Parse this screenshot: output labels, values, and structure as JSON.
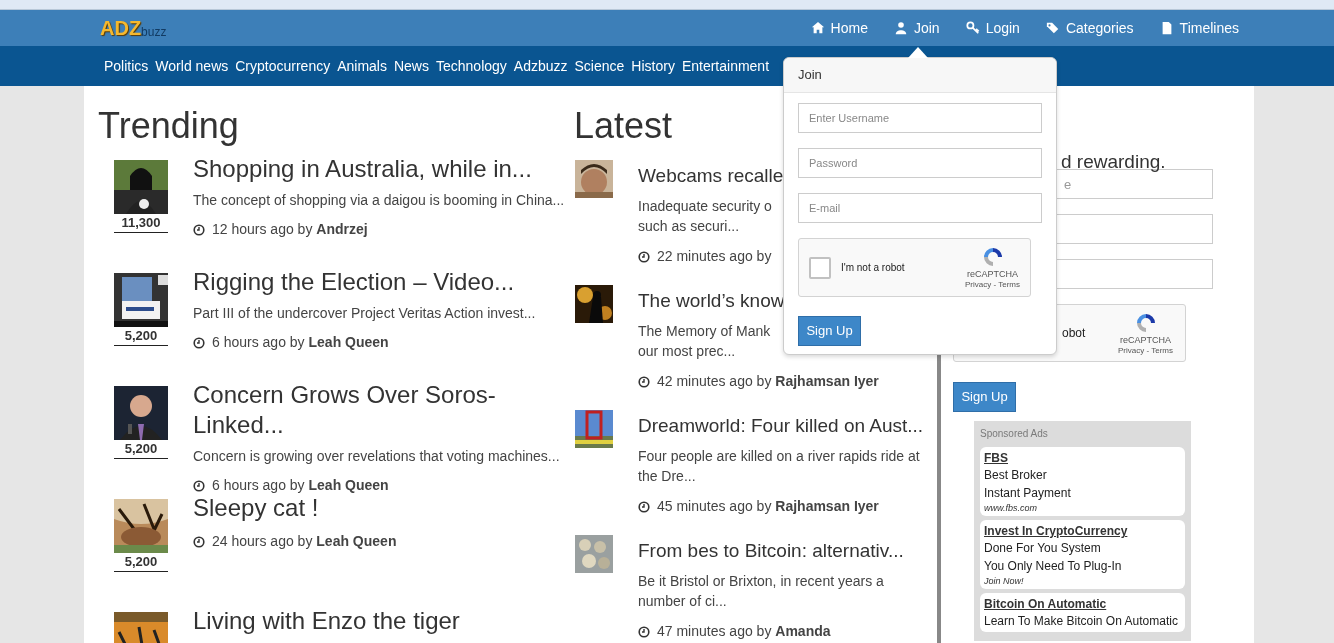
{
  "logo": {
    "primary": "ADZ",
    "secondary": "buzz"
  },
  "nav": [
    {
      "label": "Home"
    },
    {
      "label": "Join"
    },
    {
      "label": "Login"
    },
    {
      "label": "Categories"
    },
    {
      "label": "Timelines"
    }
  ],
  "categories": [
    "Politics",
    "World news",
    "Cryptocurrency",
    "Animals",
    "News",
    "Technology",
    "Adzbuzz",
    "Science",
    "History",
    "Entertainment"
  ],
  "trending": {
    "heading": "Trending",
    "items": [
      {
        "title": "Shopping in Australia, while in...",
        "count": "11,300",
        "summary": "The concept of shopping via a daigou is booming in China...",
        "meta": "12 hours ago by **Andrzej**"
      },
      {
        "title": "Rigging the Election – Video...",
        "count": "5,200",
        "summary": "Part III of the undercover Project Veritas Action invest...",
        "meta": "6 hours ago by **Leah Queen**"
      },
      {
        "title": "Concern Grows Over Soros-Linked...",
        "count": "5,200",
        "summary": "Concern is growing over revelations that voting machines...",
        "meta": "6 hours ago by **Leah Queen**"
      },
      {
        "title": "Sleepy cat !",
        "count": "5,200",
        "meta": "24 hours ago by **Leah Queen**"
      },
      {
        "title": "Living with Enzo the tiger"
      }
    ]
  },
  "latest": {
    "heading": "Latest",
    "items": [
      {
        "title": "Webcams recalle",
        "summary": [
          "Inadequate security o",
          "such as securi..."
        ],
        "meta": "22 minutes ago by"
      },
      {
        "title": "The world’s know",
        "summary": [
          "The Memory of Mank",
          "our most prec..."
        ],
        "meta": "42 minutes ago by **Rajhamsan Iyer**"
      },
      {
        "title": "Dreamworld: Four killed on Aust...",
        "summary": [
          "Four people are killed on a river rapids ride at",
          "the Dre..."
        ],
        "meta": "45 minutes ago by **Rajhamsan Iyer**"
      },
      {
        "title": "From bes to Bitcoin: alternativ...",
        "summary": [
          "Be it Bristol or Brixton, in recent years a",
          "number of ci..."
        ],
        "meta": "47 minutes ago by **Amanda**"
      }
    ]
  },
  "signup_behind": {
    "heading": "d rewarding.",
    "username_placeholder": "e",
    "captcha_label": "obot",
    "captcha_brand": "reCAPTCHA",
    "captcha_links": "Privacy - Terms",
    "button": "Sign Up"
  },
  "sponsored": {
    "heading": "Sponsored Ads",
    "ads": [
      {
        "title": "FBS",
        "lines": [
          "Best Broker",
          "Instant Payment"
        ],
        "footer": "www.fbs.com"
      },
      {
        "title": "Invest In CryptoCurrency",
        "lines": [
          "Done For You System",
          "You Only Need To Plug-In"
        ],
        "footer": "Join Now!"
      },
      {
        "title": "Bitcoin On Automatic",
        "lines": [
          "Learn To Make Bitcoin On Automatic"
        ]
      }
    ]
  },
  "join_popover": {
    "title": "Join",
    "fields": [
      {
        "placeholder": "Enter Username"
      },
      {
        "placeholder": "Password"
      },
      {
        "placeholder": "E-mail"
      }
    ],
    "captcha": {
      "label": "I'm not a robot",
      "checked": false,
      "brand": "reCAPTCHA",
      "links": "Privacy - Terms"
    },
    "button": "Sign Up"
  }
}
